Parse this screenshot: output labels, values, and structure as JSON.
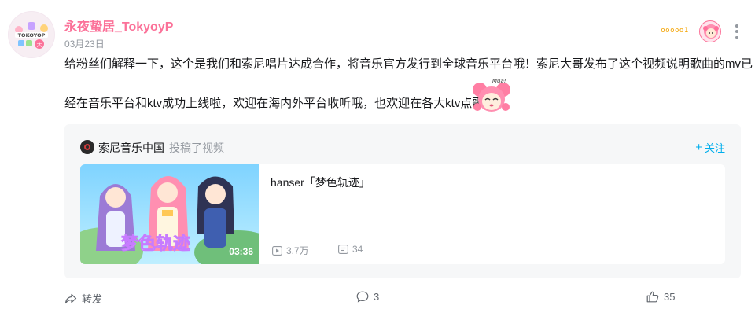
{
  "post": {
    "username": "永夜蛰居_TokyoyP",
    "date": "03月23日",
    "fan_badge": "ooooo1",
    "text_line1": "给粉丝们解释一下，这个是我们和索尼唱片达成合作，将音乐官方发行到全球音乐平台哦！索尼大哥发布了这个视频说明歌曲的mv已",
    "text_line2": "经在音乐平台和ktv成功上线啦，欢迎在海内外平台收听哦，也欢迎在各大ktv点歌"
  },
  "repost": {
    "up_name": "索尼音乐中国",
    "up_action": "投稿了视频",
    "follow_label": "关注",
    "follow_plus": "+",
    "video": {
      "title": "hanser「梦色轨迹」",
      "duration": "03:36",
      "play_count": "3.7万",
      "danmaku_count": "34"
    }
  },
  "actions": {
    "share_label": "转发",
    "comment_count": "3",
    "like_count": "35"
  },
  "colors": {
    "username": "#fb7299",
    "follow": "#00aeec",
    "muted": "#9499a0"
  }
}
